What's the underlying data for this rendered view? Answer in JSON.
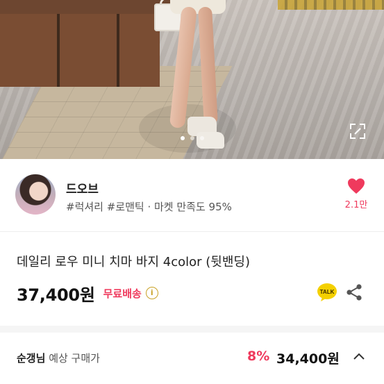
{
  "seller": {
    "name": "드오브",
    "tags": "#럭셔리 #로맨틱 · 마켓 만족도 95%",
    "likes": "2.1만"
  },
  "carousel": {
    "slides": 3,
    "active_index": 0
  },
  "product": {
    "title": "데일리 로우 미니 치마 바지 4color (뒷밴딩)",
    "price": "37,400원",
    "shipping": "무료배송",
    "talk_label": "TALK"
  },
  "purchase": {
    "user_name": "순갱님",
    "label": "예상 구매가",
    "discount_rate": "8%",
    "final_price": "34,400원"
  },
  "icons": {
    "heart": "heart-icon",
    "expand": "expand-icon",
    "info": "info-icon",
    "talk": "kakao-talk-icon",
    "share": "share-icon",
    "chevron": "chevron-up-icon"
  },
  "colors": {
    "accent": "#ef3a5d",
    "talk_yellow": "#f4d000",
    "info": "#c9a227"
  }
}
